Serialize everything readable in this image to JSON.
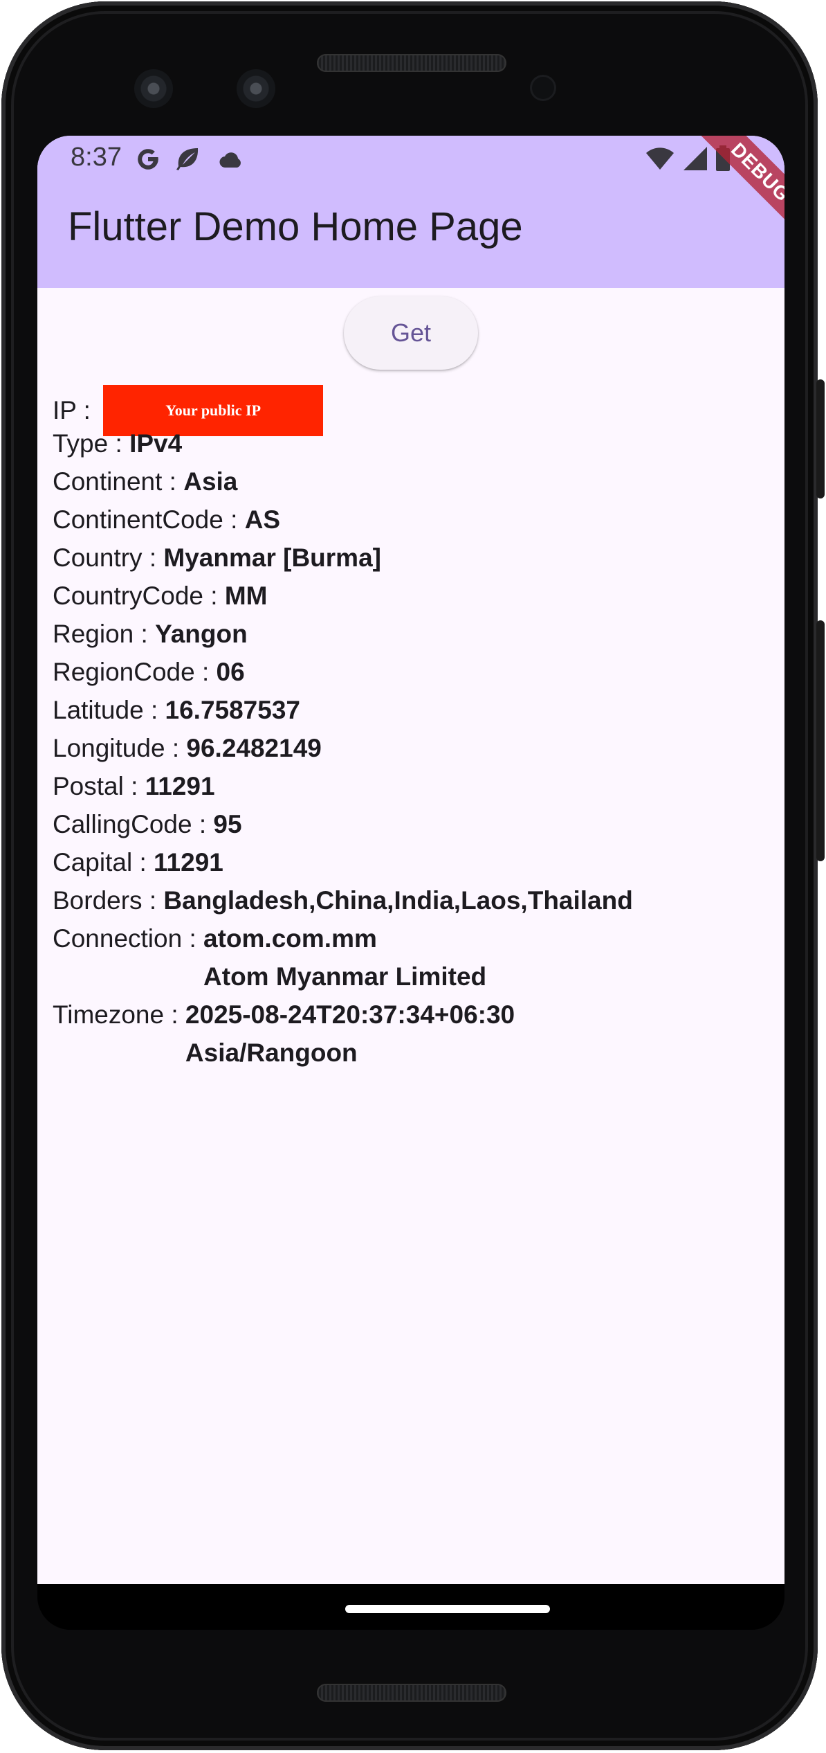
{
  "status_bar": {
    "time": "8:37",
    "left_icons": [
      "google-g-icon",
      "leaf-icon",
      "cloud-icon"
    ],
    "right_icons": [
      "wifi-icon",
      "signal-icon",
      "battery-icon"
    ]
  },
  "app_bar": {
    "title": "Flutter Demo Home Page",
    "debug_banner": "DEBUG",
    "color": "#d0bcfe"
  },
  "get_button": {
    "label": "Get"
  },
  "ip_redaction": {
    "text": "Your public IP",
    "color": "#ff2400"
  },
  "info": [
    {
      "label": "IP : ",
      "value": ""
    },
    {
      "label": "Type : ",
      "value": "IPv4"
    },
    {
      "label": "Continent : ",
      "value": "Asia"
    },
    {
      "label": "ContinentCode : ",
      "value": "AS"
    },
    {
      "label": "Country : ",
      "value": "Myanmar [Burma]"
    },
    {
      "label": "CountryCode : ",
      "value": "MM"
    },
    {
      "label": "Region : ",
      "value": "Yangon"
    },
    {
      "label": "RegionCode : ",
      "value": "06"
    },
    {
      "label": "Latitude : ",
      "value": "16.7587537"
    },
    {
      "label": "Longitude : ",
      "value": "96.2482149"
    },
    {
      "label": "Postal : ",
      "value": "11291"
    },
    {
      "label": "CallingCode : ",
      "value": "95"
    },
    {
      "label": "Capital : ",
      "value": "11291"
    },
    {
      "label": "Borders : ",
      "value": "Bangladesh,China,India,Laos,Thailand"
    },
    {
      "label": "Connection : ",
      "value": "atom.com.mm",
      "value2": "Atom Myanmar Limited"
    },
    {
      "label": "Timezone : ",
      "value": "2025-08-24T20:37:34+06:30",
      "value2": "Asia/Rangoon"
    }
  ]
}
